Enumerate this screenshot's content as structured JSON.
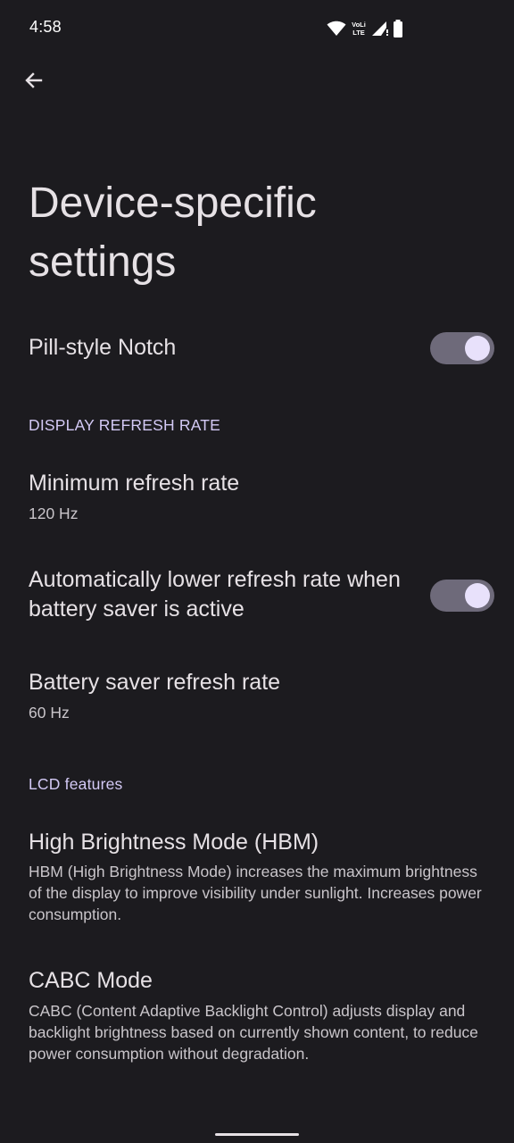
{
  "status_bar": {
    "time": "4:58",
    "icons": [
      "wifi-icon",
      "volte-icon",
      "signal-icon",
      "battery-icon"
    ],
    "volte_label_top": "VoLi",
    "volte_label_bottom": "LTE"
  },
  "header": {
    "back_icon": "arrow-back-icon"
  },
  "title": "Device-specific settings",
  "pill_notch": {
    "label": "Pill-style Notch",
    "enabled": true
  },
  "refresh_section": {
    "header": "DISPLAY REFRESH RATE",
    "min_rate": {
      "label": "Minimum refresh rate",
      "value": "120 Hz"
    },
    "auto_lower": {
      "label": "Automatically lower refresh rate when battery saver is active",
      "enabled": true
    },
    "saver_rate": {
      "label": "Battery saver refresh rate",
      "value": "60 Hz"
    }
  },
  "lcd_section": {
    "header": "LCD features",
    "hbm": {
      "label": "High Brightness Mode (HBM)",
      "summary": "HBM (High Brightness Mode) increases the maximum brightness of the display to improve visibility under sunlight. Increases power consumption."
    },
    "cabc": {
      "label": "CABC Mode",
      "summary": "CABC (Content Adaptive Backlight Control) adjusts display and backlight brightness based on currently shown content, to reduce power consumption without degradation."
    }
  },
  "colors": {
    "background": "#1c1b1f",
    "accent_header": "#d3c9f5",
    "switch_track": "#6e6a7a",
    "switch_thumb": "#e8e1fb"
  }
}
